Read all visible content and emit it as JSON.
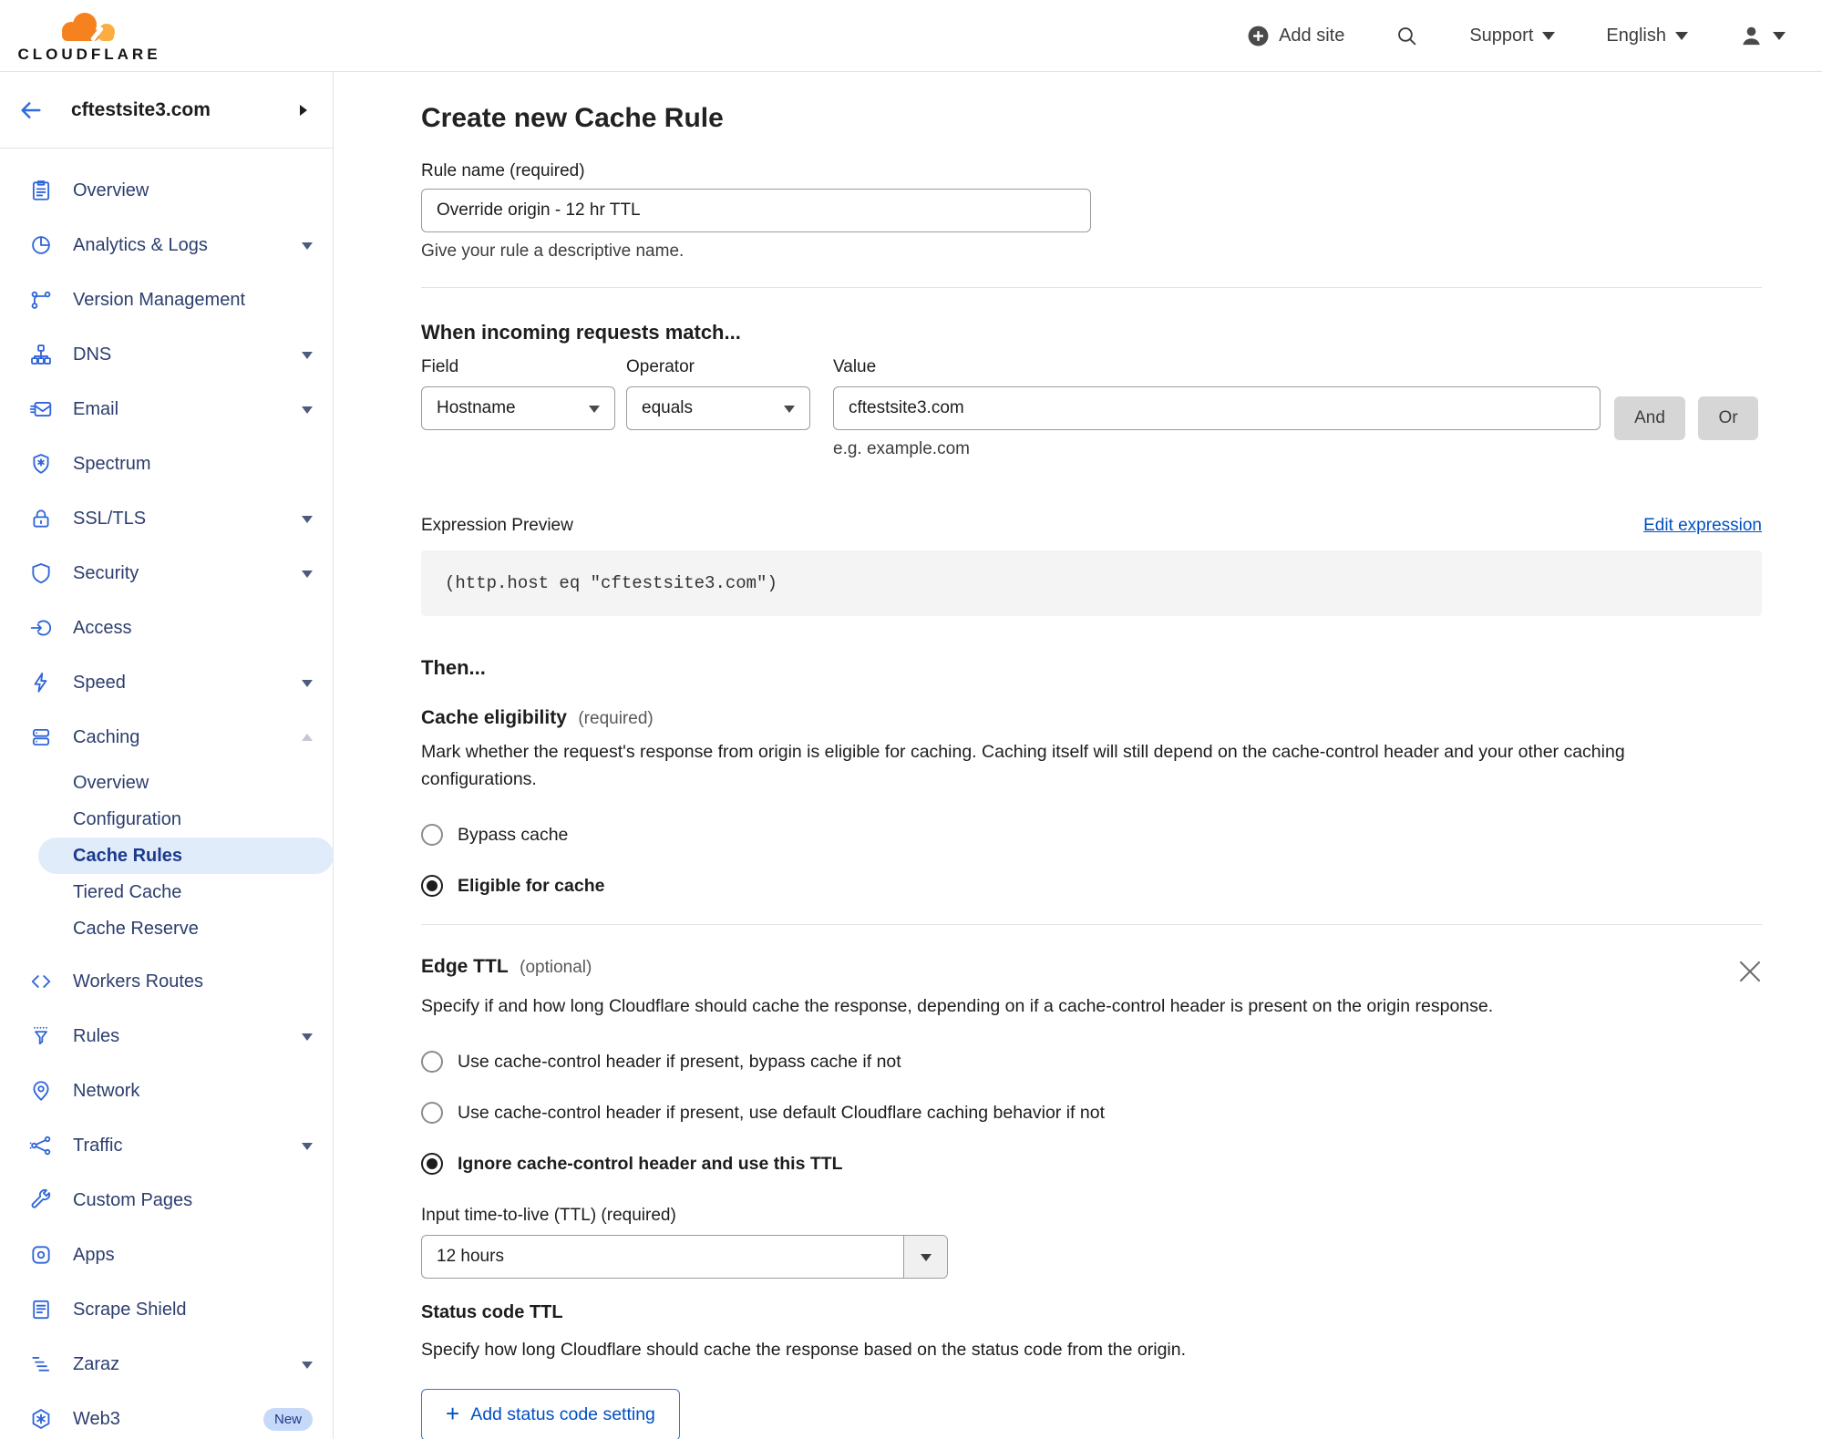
{
  "header": {
    "logo_word": "CLOUDFLARE",
    "add_site": "Add site",
    "support": "Support",
    "language": "English"
  },
  "sidebar": {
    "site_name": "cftestsite3.com",
    "items": [
      {
        "label": "Overview",
        "icon": "overview-icon"
      },
      {
        "label": "Analytics & Logs",
        "icon": "analytics-icon",
        "caret": "down"
      },
      {
        "label": "Version Management",
        "icon": "version-management-icon"
      },
      {
        "label": "DNS",
        "icon": "dns-icon",
        "caret": "down"
      },
      {
        "label": "Email",
        "icon": "email-icon",
        "caret": "down"
      },
      {
        "label": "Spectrum",
        "icon": "spectrum-icon"
      },
      {
        "label": "SSL/TLS",
        "icon": "ssl-tls-icon",
        "caret": "down"
      },
      {
        "label": "Security",
        "icon": "security-icon",
        "caret": "down"
      },
      {
        "label": "Access",
        "icon": "access-icon"
      },
      {
        "label": "Speed",
        "icon": "speed-icon",
        "caret": "down"
      },
      {
        "label": "Caching",
        "icon": "caching-icon",
        "caret": "up",
        "children": [
          {
            "label": "Overview"
          },
          {
            "label": "Configuration"
          },
          {
            "label": "Cache Rules",
            "active": true
          },
          {
            "label": "Tiered Cache"
          },
          {
            "label": "Cache Reserve"
          }
        ]
      },
      {
        "label": "Workers Routes",
        "icon": "workers-routes-icon"
      },
      {
        "label": "Rules",
        "icon": "rules-icon",
        "caret": "down"
      },
      {
        "label": "Network",
        "icon": "network-icon"
      },
      {
        "label": "Traffic",
        "icon": "traffic-icon",
        "caret": "down"
      },
      {
        "label": "Custom Pages",
        "icon": "custom-pages-icon"
      },
      {
        "label": "Apps",
        "icon": "apps-icon"
      },
      {
        "label": "Scrape Shield",
        "icon": "scrape-shield-icon"
      },
      {
        "label": "Zaraz",
        "icon": "zaraz-icon",
        "caret": "down"
      },
      {
        "label": "Web3",
        "icon": "web3-icon",
        "badge": "New"
      }
    ]
  },
  "main": {
    "title": "Create new Cache Rule",
    "rule_name": {
      "label": "Rule name (required)",
      "value": "Override origin - 12 hr TTL",
      "help": "Give your rule a descriptive name."
    },
    "match": {
      "heading": "When incoming requests match...",
      "field_label": "Field",
      "field_value": "Hostname",
      "operator_label": "Operator",
      "operator_value": "equals",
      "value_label": "Value",
      "value_value": "cftestsite3.com",
      "value_hint": "e.g. example.com",
      "and_label": "And",
      "or_label": "Or"
    },
    "expression": {
      "label": "Expression Preview",
      "edit_link": "Edit expression",
      "code": "(http.host eq \"cftestsite3.com\")"
    },
    "then_heading": "Then...",
    "eligibility": {
      "heading": "Cache eligibility",
      "required": "(required)",
      "description": "Mark whether the request's response from origin is eligible for caching. Caching itself will still depend on the cache-control header and your other caching configurations.",
      "options": [
        {
          "label": "Bypass cache",
          "selected": false
        },
        {
          "label": "Eligible for cache",
          "selected": true
        }
      ]
    },
    "edge_ttl": {
      "heading": "Edge TTL",
      "optional": "(optional)",
      "description": "Specify if and how long Cloudflare should cache the response, depending on if a cache-control header is present on the origin response.",
      "options": [
        {
          "label": "Use cache-control header if present, bypass cache if not",
          "selected": false
        },
        {
          "label": "Use cache-control header if present, use default Cloudflare caching behavior if not",
          "selected": false
        },
        {
          "label": "Ignore cache-control header and use this TTL",
          "selected": true
        }
      ],
      "ttl_label": "Input time-to-live (TTL) (required)",
      "ttl_value": "12 hours"
    },
    "status_code": {
      "heading": "Status code TTL",
      "description": "Specify how long Cloudflare should cache the response based on the status code from the origin.",
      "add_button": "Add status code setting"
    }
  },
  "colors": {
    "accent_link": "#0051c3",
    "sidebar_icon": "#3065da",
    "sidebar_text": "#2c3e6e",
    "active_item_bg": "#e1ecfb",
    "active_item_text": "#1b3a8c",
    "logo_orange": "#f6821f",
    "logo_light_orange": "#fbad41",
    "button_gray_bg": "#d6d6d6",
    "code_bg": "#f4f4f4"
  }
}
